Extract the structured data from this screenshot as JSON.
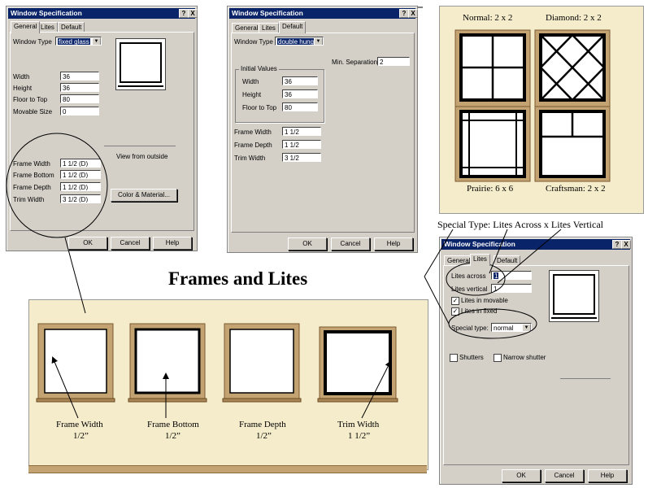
{
  "heading": "Frames and Lites",
  "dialog_title": "Window Specification",
  "title_buttons": {
    "help": "?",
    "close": "X"
  },
  "common_buttons": {
    "ok": "OK",
    "cancel": "Cancel",
    "help": "Help"
  },
  "dialog1": {
    "tabs": [
      "General",
      "Lites",
      "Default"
    ],
    "window_type_label": "Window Type",
    "window_type_value": "fixed glass",
    "fields": [
      {
        "label": "Width",
        "value": "36"
      },
      {
        "label": "Height",
        "value": "36"
      },
      {
        "label": "Floor to Top",
        "value": "80"
      },
      {
        "label": "Movable Size",
        "value": "0"
      }
    ],
    "frame_fields": [
      {
        "label": "Frame Width",
        "value": "1 1/2 (D)"
      },
      {
        "label": "Frame Bottom",
        "value": "1 1/2 (D)"
      },
      {
        "label": "Frame Depth",
        "value": "1 1/2 (D)"
      },
      {
        "label": "Trim Width",
        "value": "3 1/2 (D)"
      }
    ],
    "view_label": "View from outside",
    "color_button": "Color & Material..."
  },
  "dialog2": {
    "tabs": [
      "General",
      "Lites",
      "Default"
    ],
    "window_type_label": "Window Type",
    "window_type_value": "double hung",
    "min_sep_label": "Min. Separation",
    "min_sep_value": "2",
    "group_label": "Initial Values",
    "fields": [
      {
        "label": "Width",
        "value": "36"
      },
      {
        "label": "Height",
        "value": "36"
      },
      {
        "label": "Floor to Top",
        "value": "80"
      }
    ],
    "frame_fields": [
      {
        "label": "Frame Width",
        "value": "1 1/2"
      },
      {
        "label": "Frame Depth",
        "value": "1 1/2"
      },
      {
        "label": "Trim Width",
        "value": "3 1/2"
      }
    ]
  },
  "dialog3": {
    "tabs": [
      "General",
      "Lites",
      "Default"
    ],
    "lites_across_label": "Lites across",
    "lites_across_value": "1",
    "lites_vertical_label": "Lites vertical",
    "lites_vertical_value": "1",
    "lites_in_movable": "Lites in movable",
    "lites_in_fixed": "Lites in fixed",
    "special_type_label": "Special type:",
    "special_type_value": "normal",
    "shutters": "Shutters",
    "narrow_shutter": "Narrow shutter"
  },
  "lite_types": [
    {
      "caption": "Normal:  2 x 2"
    },
    {
      "caption": "Diamond:  2 x 2"
    },
    {
      "caption": "Prairie:  6 x 6"
    },
    {
      "caption": "Craftsman: 2 x 2"
    }
  ],
  "special_type_caption": "Special Type:  Lites Across x Lites Vertical",
  "frame_examples": [
    {
      "name": "Frame Width",
      "value": "1/2”"
    },
    {
      "name": "Frame Bottom",
      "value": "1/2”"
    },
    {
      "name": "Frame Depth",
      "value": "1/2”"
    },
    {
      "name": "Trim Width",
      "value": "1 1/2”"
    }
  ]
}
